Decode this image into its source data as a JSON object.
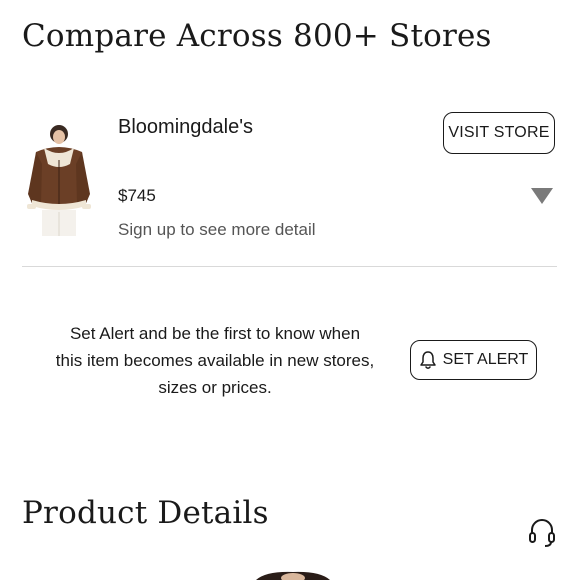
{
  "compare": {
    "title": "Compare Across 800+ Stores"
  },
  "store": {
    "name": "Bloomingdale's",
    "price": "$745",
    "note": "Sign up to see more detail",
    "visit_label": "VISIT STORE"
  },
  "alert": {
    "line1": "Set Alert and be the first to know when",
    "line2": "this item becomes available in new stores,",
    "line3": "sizes or prices.",
    "button_label": "SET ALERT"
  },
  "details": {
    "title": "Product Details"
  },
  "colors": {
    "text": "#1a1a1a",
    "muted": "#555555",
    "divider": "#d9d9d9",
    "caret": "#7a7a7a",
    "jacket": "#6b3f26",
    "shearling": "#efe6d6"
  },
  "icons": {
    "expand": "chevron-down-icon",
    "alert": "bell-icon",
    "support": "headset-icon"
  }
}
